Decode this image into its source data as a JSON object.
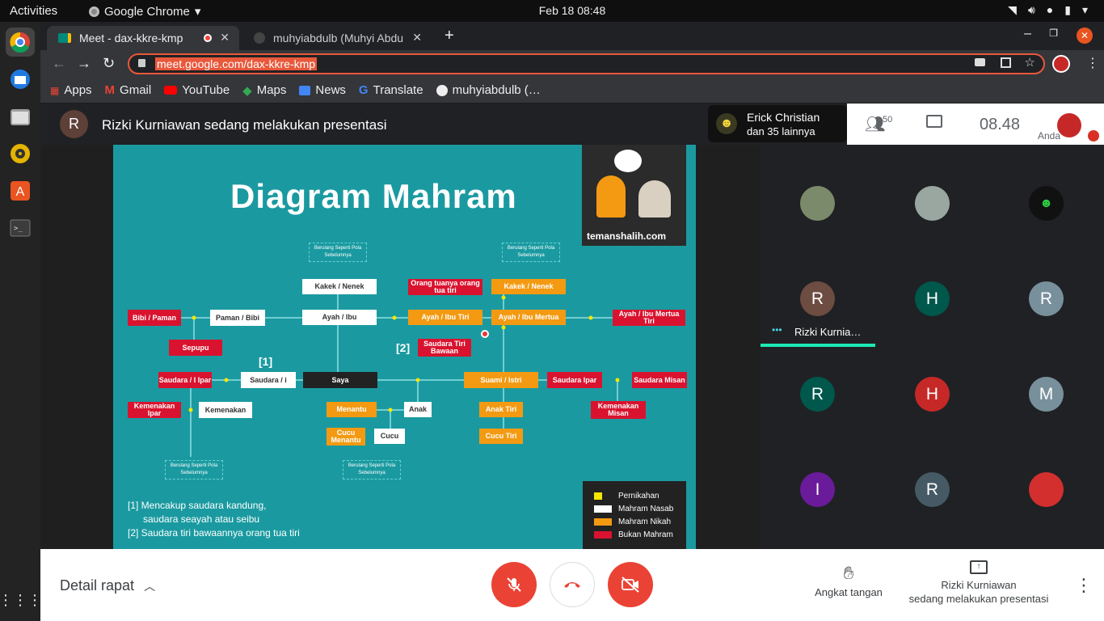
{
  "topbar": {
    "activities": "Activities",
    "app": "Google Chrome",
    "datetime": "Feb 18  08:48"
  },
  "browser": {
    "tabs": [
      {
        "title": "Meet - dax-kkre-kmp"
      },
      {
        "title": "muhyiabdulb (Muhyi Abdu"
      }
    ],
    "url": "meet.google.com/dax-kkre-kmp",
    "bookmarks": [
      "Apps",
      "Gmail",
      "YouTube",
      "Maps",
      "News",
      "Translate",
      "muhyiabdulb (…"
    ]
  },
  "meet": {
    "presenter_initial": "R",
    "presenting_text": "Rizki Kurniawan sedang melakukan presentasi",
    "notification": {
      "line1": "Erick Christian",
      "line2": "dan 35 lainnya"
    },
    "participant_count": "50",
    "time": "08.48",
    "self_label": "Anda",
    "active_speaker": "Rizki Kurnia…",
    "tiles": [
      {
        "initial": "",
        "color": "#7a8a6a"
      },
      {
        "initial": "",
        "color": "#9aa6a0"
      },
      {
        "initial": "",
        "color": "#111"
      },
      {
        "initial": "R",
        "color": "#6d4c41"
      },
      {
        "initial": "H",
        "color": "#00574b"
      },
      {
        "initial": "R",
        "color": "#78909c"
      },
      {
        "initial": "R",
        "color": "#00574b"
      },
      {
        "initial": "H",
        "color": "#c62828"
      },
      {
        "initial": "M",
        "color": "#78909c"
      },
      {
        "initial": "I",
        "color": "#6a1b9a"
      },
      {
        "initial": "R",
        "color": "#455a64"
      },
      {
        "initial": "",
        "color": "#d32f2f"
      }
    ],
    "details_label": "Detail rapat",
    "raise_hand_label": "Angkat tangan",
    "present_line1": "Rizki Kurniawan",
    "present_line2": "sedang melakukan presentasi"
  },
  "slide": {
    "title": "Diagram Mahram",
    "site": "temanshalih.com",
    "notes": {
      "n1": "Berulang Seperti Pola Sebelumnya"
    },
    "boxes": {
      "kakek_nenek_l": "Kakek / Nenek",
      "orang_tua_tiri": "Orang tuanya orang tua tiri",
      "kakek_nenek_r": "Kakek / Nenek",
      "bibi_paman": "Bibi / Paman",
      "paman_bibi": "Paman / Bibi",
      "ayah_ibu": "Ayah / Ibu",
      "ayah_ibu_tiri": "Ayah / Ibu Tiri",
      "ayah_ibu_mertua": "Ayah / Ibu Mertua",
      "ayah_ibu_mertua_tiri": "Ayah / Ibu Mertua Tiri",
      "sepupu": "Sepupu",
      "saudara_tiri_bawaan": "Saudara Tiri Bawaan",
      "saudara_ipar_l": "Saudara / I Ipar",
      "saudara_i": "Saudara / i",
      "saya": "Saya",
      "suami_istri": "Suami / Istri",
      "saudara_ipar_r": "Saudara Ipar",
      "saudara_misan": "Saudara Misan",
      "kemenakan_ipar": "Kemenakan Ipar",
      "kemenakan": "Kemenakan",
      "menantu": "Menantu",
      "anak": "Anak",
      "anak_tiri": "Anak Tiri",
      "kemenakan_misan": "Kemenakan Misan",
      "cucu_menantu": "Cucu Menantu",
      "cucu": "Cucu",
      "cucu_tiri": "Cucu Tiri"
    },
    "markers": {
      "m1": "[1]",
      "m2": "[2]"
    },
    "footnotes": [
      "[1] Mencakup saudara kandung,",
      "saudara seayah atau seibu",
      "[2] Saudara tiri bawaannya orang tua tiri"
    ],
    "legend": [
      {
        "label": "Pernikahan",
        "color": "#f5e600"
      },
      {
        "label": "Mahram Nasab",
        "color": "#ffffff"
      },
      {
        "label": "Mahram Nikah",
        "color": "#f39a12"
      },
      {
        "label": "Bukan Mahram",
        "color": "#d9132f"
      }
    ]
  }
}
